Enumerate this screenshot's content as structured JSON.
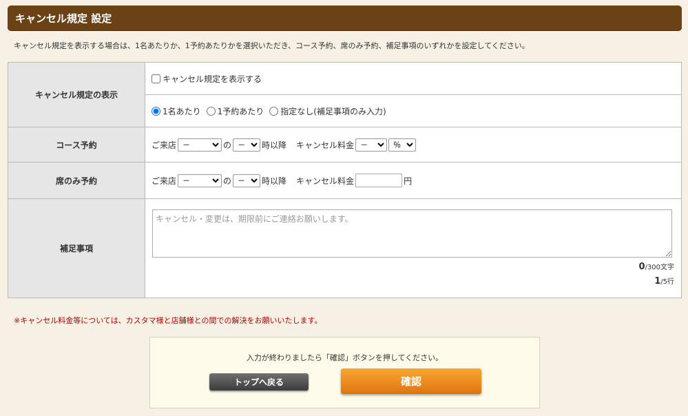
{
  "header": {
    "title": "キャンセル規定 設定"
  },
  "intro_text": "キャンセル規定を表示する場合は、1名あたりか、1予約あたりかを選択いただき、コース予約、席のみ予約、補足事項のいずれかを設定してください。",
  "rows": {
    "display": {
      "label": "キャンセル規定の表示",
      "checkbox_label": "キャンセル規定を表示する",
      "checkbox_checked": false,
      "radio_options": [
        "1名あたり",
        "1予約あたり",
        "指定なし(補足事項のみ入力)"
      ],
      "radio_selected": "1名あたり"
    },
    "course": {
      "label": "コース予約",
      "prefix": "ご来店",
      "day_value": "－",
      "no": "の",
      "time_value": "－",
      "after": "時以降",
      "fee_label": "キャンセル料金",
      "fee_value": "－",
      "unit_value": "％"
    },
    "seat": {
      "label": "席のみ予約",
      "prefix": "ご来店",
      "day_value": "－",
      "no": "の",
      "time_value": "－",
      "after": "時以降",
      "fee_label": "キャンセル料金",
      "fee_input": "",
      "yen": "円"
    },
    "note": {
      "label": "補足事項",
      "placeholder": "キャンセル・変更は、期限前にご連絡お願いします。",
      "char_count": "0",
      "char_max": "/300文字",
      "line_count": "1",
      "line_max": "/5行"
    }
  },
  "notice": "※キャンセル料金等については、カスタマ様と店舗様との間での解決をお願いいたします。",
  "actions": {
    "message": "入力が終わりましたら「確認」ボタンを押してください。",
    "back_label": "トップへ戻る",
    "confirm_label": "確認"
  },
  "colors": {
    "header_bg": "#6a4216",
    "background": "#f6f1e4",
    "th_bg": "#e6e6e6",
    "notice": "#b40000",
    "confirm_btn": "#ef8d20",
    "back_btn": "#555555"
  }
}
